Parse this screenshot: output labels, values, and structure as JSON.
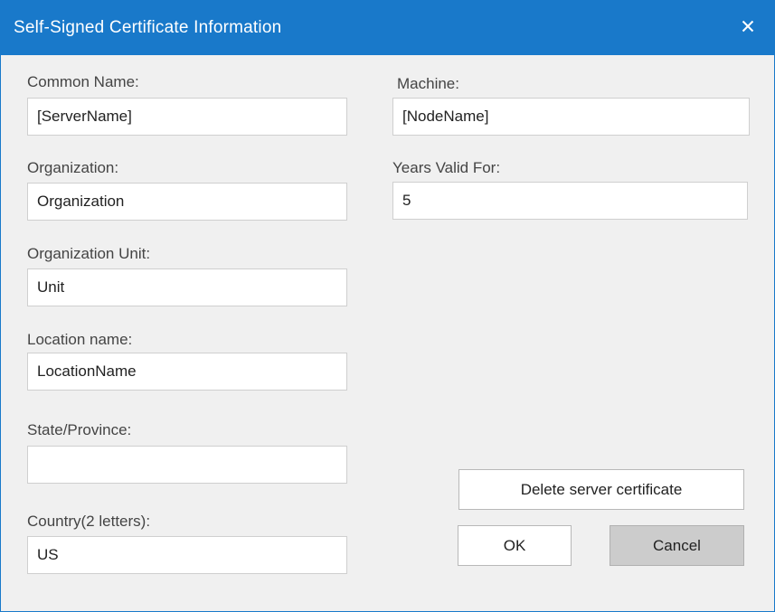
{
  "window": {
    "title": "Self-Signed Certificate Information",
    "close_glyph": "close-icon"
  },
  "fields": {
    "common_name": {
      "label": "Common Name:",
      "value": "[ServerName]"
    },
    "organization": {
      "label": "Organization:",
      "value": "Organization"
    },
    "organization_unit": {
      "label": "Organization Unit:",
      "value": "Unit"
    },
    "location_name": {
      "label": "Location name:",
      "value": "LocationName"
    },
    "state_province": {
      "label": "State/Province:",
      "value": ""
    },
    "country": {
      "label": "Country(2 letters):",
      "value": "US"
    },
    "machine": {
      "label": "Machine:",
      "value": "[NodeName]"
    },
    "years_valid": {
      "label": "Years Valid For:",
      "value": "5"
    }
  },
  "buttons": {
    "delete_cert": "Delete server certificate",
    "ok": "OK",
    "cancel": "Cancel"
  },
  "colors": {
    "titlebar": "#1979ca",
    "dialog_bg": "#f0f0f0",
    "cancel_bg": "#cccccc"
  }
}
